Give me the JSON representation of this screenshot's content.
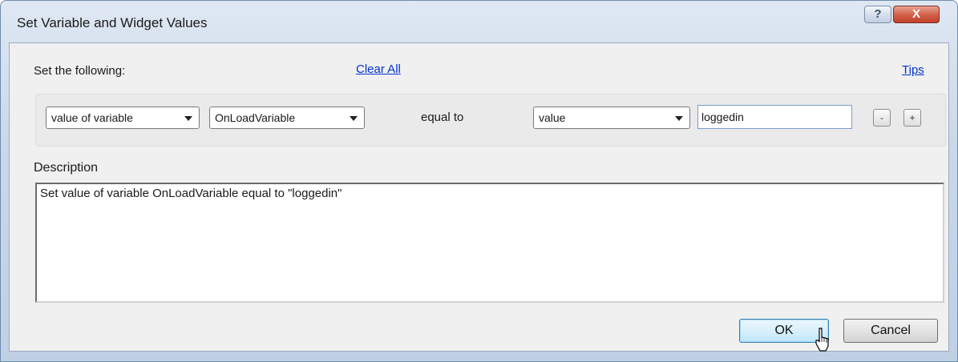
{
  "window": {
    "title": "Set Variable and Widget Values",
    "help_label": "?",
    "close_label": "X"
  },
  "form": {
    "set_label": "Set the following:",
    "clear_all_label": "Clear All",
    "tips_label": "Tips",
    "row": {
      "target_type": "value of variable",
      "variable_name": "OnLoadVariable",
      "operator_label": "equal to",
      "value_type": "value",
      "value_text": "loggedin",
      "remove_label": "-",
      "add_label": "+"
    },
    "description_label": "Description",
    "description_text": "Set value of variable OnLoadVariable equal to \"loggedin\""
  },
  "buttons": {
    "ok_label": "OK",
    "cancel_label": "Cancel"
  },
  "colors": {
    "link": "#0033cc",
    "close_button": "#c0402a",
    "ok_border": "#3c7fb1"
  }
}
